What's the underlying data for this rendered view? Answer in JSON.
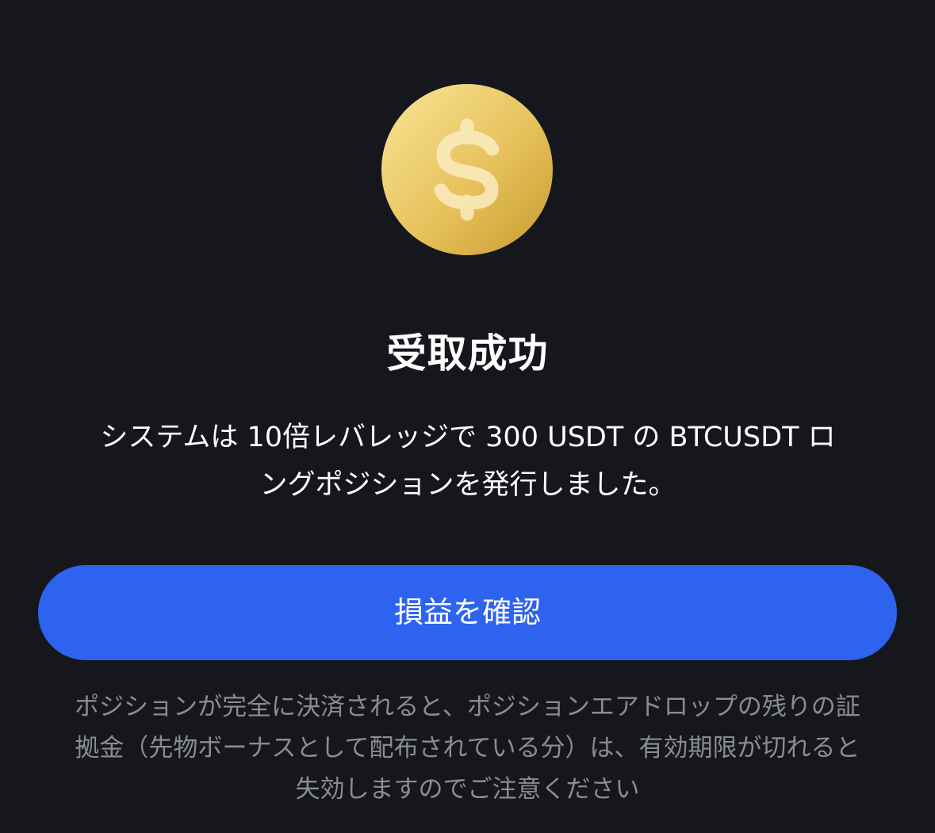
{
  "dialog": {
    "icon": "dollar-coin-icon",
    "title": "受取成功",
    "message_line1": "システムは 10倍レバレッジで 300 USDT の BTCUSDT ロ",
    "message_line2": "ングポジションを発行しました。",
    "button_label": "損益を確認",
    "note_line1": "ポジションが完全に決済されると、ポジションエアドロップの残りの証",
    "note_line2": "拠金（先物ボーナスとして配布されている分）は、有効期限が切れると",
    "note_line3": "失効しますのでご注意ください"
  },
  "colors": {
    "background": "#16171c",
    "button": "#2d63ee",
    "coin_light": "#f6df8a",
    "coin_dark": "#d6a534",
    "note_text": "#8a8c95"
  }
}
